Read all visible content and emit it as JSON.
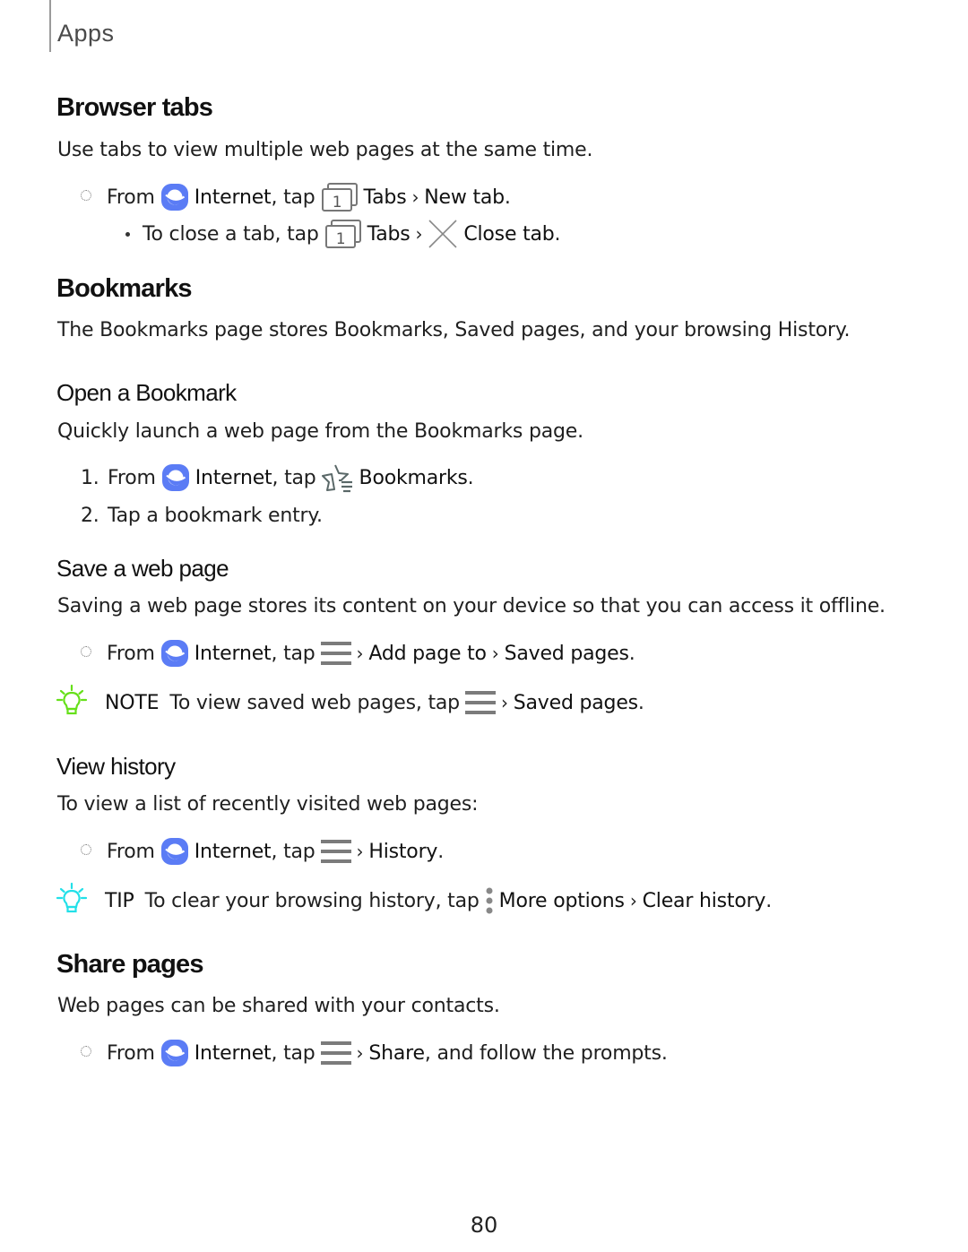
{
  "header": {
    "chapter": "Apps"
  },
  "sections": {
    "browser_tabs": {
      "title": "Browser tabs",
      "intro": "Use tabs to view multiple web pages at the same time.",
      "step": {
        "from": "From",
        "app": "Internet",
        "tap": ", tap",
        "tabs": "Tabs",
        "action": "New tab",
        "end": "."
      },
      "sub": {
        "text": "To close a tab, tap",
        "tabs": "Tabs",
        "action": "Close tab",
        "end": "."
      }
    },
    "bookmarks": {
      "title": "Bookmarks",
      "intro": "The Bookmarks page stores Bookmarks, Saved pages, and your browsing History."
    },
    "open_bookmark": {
      "title": "Open a Bookmark",
      "intro": "Quickly launch a web page from the Bookmarks page.",
      "steps": [
        {
          "num": "1.",
          "from": "From",
          "app": "Internet",
          "tap": ", tap",
          "target": "Bookmarks",
          "end": "."
        },
        {
          "num": "2.",
          "text": "Tap a bookmark entry."
        }
      ]
    },
    "save_page": {
      "title": "Save a web page",
      "intro": "Saving a web page stores its content on your device so that you can access it offline.",
      "step": {
        "from": "From",
        "app": "Internet",
        "tap": ", tap",
        "action1": "Add page to",
        "action2": "Saved pages",
        "end": "."
      },
      "note": {
        "label": "NOTE",
        "text": "To view saved web pages, tap",
        "action": "Saved pages",
        "end": ".",
        "icon_color": "#66e01a"
      }
    },
    "view_history": {
      "title": "View history",
      "intro": "To view a list of recently visited web pages:",
      "step": {
        "from": "From",
        "app": "Internet",
        "tap": ", tap",
        "action": "History",
        "end": "."
      },
      "tip": {
        "label": "TIP",
        "text": "To clear your browsing history, tap",
        "action1": "More options",
        "action2": "Clear history",
        "end": ".",
        "icon_color": "#22e0e8"
      }
    },
    "share_pages": {
      "title": "Share pages",
      "intro": "Web pages can be shared with your contacts.",
      "step": {
        "from": "From",
        "app": "Internet",
        "tap": ", tap",
        "action": "Share",
        "rest": ", and follow the prompts."
      }
    }
  },
  "icons": {
    "internet_app": "internet-app-icon",
    "tabs": "tabs-icon",
    "close": "close-x-icon",
    "bookmarks": "bookmark-star-icon",
    "menu": "hamburger-menu-icon",
    "more_options": "more-options-icon",
    "lightbulb": "lightbulb-icon",
    "tabs_count": "1"
  },
  "colors": {
    "internet_app": "#5b7cf5",
    "icon_gray": "#7b7b7b"
  },
  "footer": {
    "page_number": "80"
  }
}
